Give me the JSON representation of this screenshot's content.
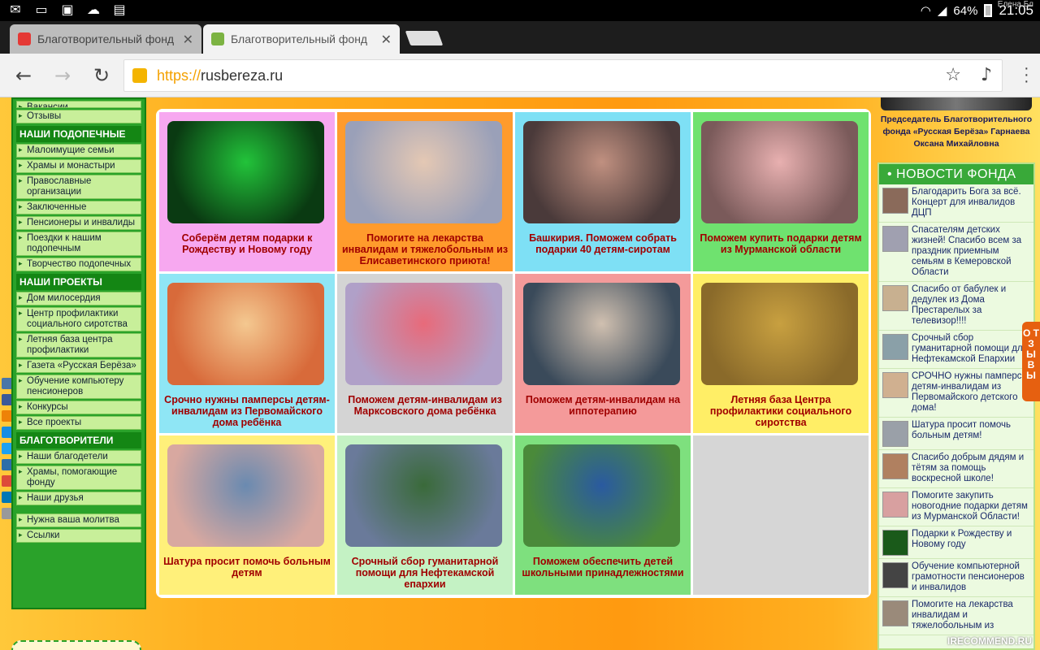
{
  "statusbar": {
    "user": "Елена Бл",
    "battery": "64%",
    "time": "21:05",
    "icons": [
      "mail-icon",
      "cast-icon",
      "gallery-icon",
      "weather-icon",
      "clipboard-icon"
    ]
  },
  "tabs": [
    {
      "title": "Благотворительный фонд",
      "favicon_color": "#e53935",
      "active": false
    },
    {
      "title": "Благотворительный фонд",
      "favicon_color": "#7cb342",
      "active": true
    }
  ],
  "address": {
    "scheme": "https://",
    "host": "rusbereza.ru"
  },
  "leftnav": {
    "top_items": [
      "Вакансии",
      "Отзывы"
    ],
    "sections": [
      {
        "title": "НАШИ ПОДОПЕЧНЫЕ",
        "items": [
          "Малоимущие семьи",
          "Храмы и монастыри",
          "Православные организации",
          "Заключенные",
          "Пенсионеры и инвалиды",
          "Поездки к нашим подопечным",
          "Творчество подопечных"
        ]
      },
      {
        "title": "НАШИ ПРОЕКТЫ",
        "items": [
          "Дом милосердия",
          "Центр профилактики социального сиротства",
          "Летняя база центра профилактики",
          "Газета «Русская Берёза»",
          "Обучение компьютеру пенсионеров",
          "Конкурсы",
          "Все проекты"
        ]
      },
      {
        "title": "БЛАГОТВОРИТЕЛИ",
        "items": [
          "Наши благодетели",
          "Храмы, помогающие фонду",
          "Наши друзья"
        ]
      }
    ],
    "bottom_items": [
      "Нужна ваша молитва",
      "Ссылки"
    ]
  },
  "share_icons": [
    "vk-icon",
    "facebook-icon",
    "odnoklassniki-icon",
    "mailru-icon",
    "twitter-icon",
    "livejournal-icon",
    "googleplus-icon",
    "linkedin-icon",
    "other-icon"
  ],
  "cards": [
    {
      "caption": "Соберём детям подарки к Рождеству и Новому году",
      "bg": "#f7a8f0",
      "photo": [
        "#0a3a12",
        "#22c33a"
      ]
    },
    {
      "caption": "Помогите на лекарства инвалидам и тяжелобольным из Елисаветинского приюта!",
      "bg": "#ff9b2c",
      "photo": [
        "#9aa0b8",
        "#e4c8b4"
      ]
    },
    {
      "caption": "Башкирия. Поможем собрать подарки 40 детям-сиротам",
      "bg": "#7ee0f5",
      "photo": [
        "#4a3a3a",
        "#c09080"
      ]
    },
    {
      "caption": "Поможем купить подарки детям из Мурманской области",
      "bg": "#6fe26f",
      "photo": [
        "#7a5a5a",
        "#e8b0b0"
      ]
    },
    {
      "caption": "Срочно нужны памперсы детям-инвалидам из Первомайского дома ребёнка",
      "bg": "#8fe6f5",
      "photo": [
        "#d86a3a",
        "#f4c890"
      ]
    },
    {
      "caption": "Поможем детям-инвалидам из Марксовского дома ребёнка",
      "bg": "#d4d4d4",
      "photo": [
        "#b0a0c8",
        "#e86a7a"
      ]
    },
    {
      "caption": "Поможем детям-инвалидам на иппотерапию",
      "bg": "#f49a9a",
      "photo": [
        "#3a4a5a",
        "#d0c0b0"
      ]
    },
    {
      "caption": "Летняя база Центра профилактики социального сиротства",
      "bg": "#ffee66",
      "photo": [
        "#8a6a2a",
        "#c8a040"
      ]
    },
    {
      "caption": "Шатура просит помочь больным детям",
      "bg": "#fff07a",
      "photo": [
        "#d8a8a0",
        "#6a8ab0"
      ]
    },
    {
      "caption": "Срочный сбор гуманитарной помощи для Нефтекамской епархии",
      "bg": "#c4f2c4",
      "photo": [
        "#6a7a9a",
        "#3a6a3a"
      ]
    },
    {
      "caption": "Поможем обеспечить детей школьными принадлежностями",
      "bg": "#7ee07e",
      "photo": [
        "#4a8a3a",
        "#2a5aa0"
      ]
    },
    {
      "caption": "",
      "bg": "#d6d6d6",
      "photo": null
    }
  ],
  "chair_caption": "Председатель Благотворительного фонда «Русская Берёза» Гарнаева Оксана Михайловна",
  "news_title": "• НОВОСТИ ФОНДА",
  "news": [
    "Благодарить Бога за всё. Концерт для инвалидов ДЦП",
    "Спасателям детских жизней! Спасибо всем за праздник приемным семьям в Кемеровской Области",
    "Спасибо от бабулек и дедулек из Дома Престарелых за телевизор!!!!",
    "Срочный сбор гуманитарной помощи для Нефтекамской Епархии",
    "СРОЧНО нужны памперсы детям-инвалидам из Первомайского детского дома!",
    "Шатура просит помочь больным детям!",
    "Спасибо добрым дядям и тётям за помощь воскресной школе!",
    "Помогите закупить новогодние подарки детям из Мурманской Области!",
    "Подарки к Рождеству и Новому году",
    "Обучение компьютерной грамотности пенсионеров и инвалидов",
    "Помогите на лекарства инвалидам и тяжелобольным из"
  ],
  "otzyvy": "О Т З Ы В Ы",
  "watermark": "IRECOMMEND.RU"
}
